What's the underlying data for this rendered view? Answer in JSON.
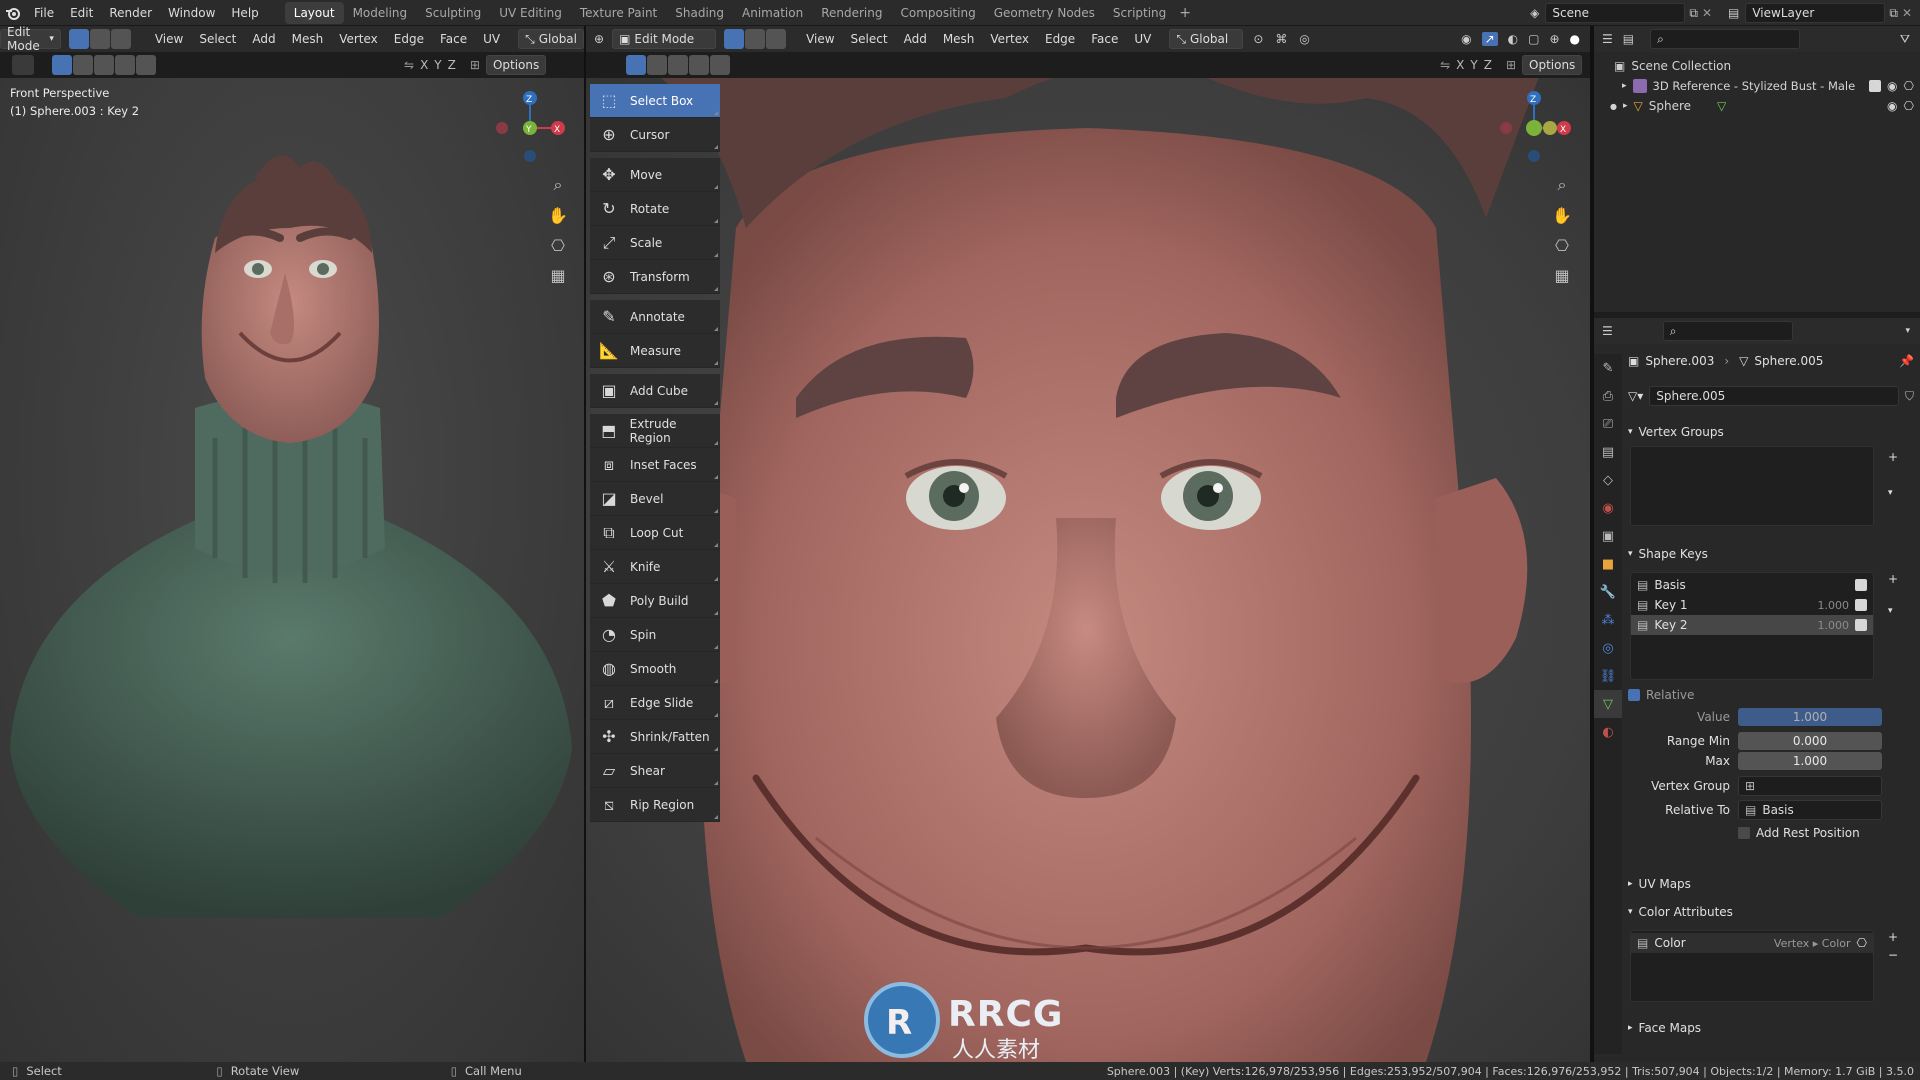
{
  "topbar": {
    "menu": [
      "File",
      "Edit",
      "Render",
      "Window",
      "Help"
    ],
    "workspaces": [
      "Layout",
      "Modeling",
      "Sculpting",
      "UV Editing",
      "Texture Paint",
      "Shading",
      "Animation",
      "Rendering",
      "Compositing",
      "Geometry Nodes",
      "Scripting"
    ],
    "active_workspace": "Layout",
    "scene_name": "Scene",
    "view_layer_name": "ViewLayer"
  },
  "left_header": {
    "mode": "Edit Mode",
    "menus": [
      "View",
      "Select",
      "Add",
      "Mesh",
      "Vertex",
      "Edge",
      "Face",
      "UV"
    ],
    "orientation": "Global",
    "axes": [
      "X",
      "Y",
      "Z"
    ],
    "options_label": "Options"
  },
  "right_header": {
    "mode": "Edit Mode",
    "menus": [
      "View",
      "Select",
      "Add",
      "Mesh",
      "Vertex",
      "Edge",
      "Face",
      "UV"
    ],
    "orientation": "Global",
    "axes": [
      "X",
      "Y",
      "Z"
    ],
    "options_label": "Options"
  },
  "left_viewport": {
    "view_name": "Front Perspective",
    "object_info": "(1) Sphere.003 : Key 2"
  },
  "toolbar": {
    "tools": [
      {
        "label": "Select Box",
        "icon": "select-box-icon",
        "active": true,
        "gap": false
      },
      {
        "label": "Cursor",
        "icon": "cursor-icon",
        "active": false,
        "gap": false
      },
      {
        "label": "Move",
        "icon": "move-icon",
        "active": false,
        "gap": true
      },
      {
        "label": "Rotate",
        "icon": "rotate-icon",
        "active": false,
        "gap": false
      },
      {
        "label": "Scale",
        "icon": "scale-icon",
        "active": false,
        "gap": false
      },
      {
        "label": "Transform",
        "icon": "transform-icon",
        "active": false,
        "gap": false
      },
      {
        "label": "Annotate",
        "icon": "annotate-icon",
        "active": false,
        "gap": true
      },
      {
        "label": "Measure",
        "icon": "measure-icon",
        "active": false,
        "gap": false
      },
      {
        "label": "Add Cube",
        "icon": "add-cube-icon",
        "active": false,
        "gap": true
      },
      {
        "label": "Extrude Region",
        "icon": "extrude-region-icon",
        "active": false,
        "gap": true
      },
      {
        "label": "Inset Faces",
        "icon": "inset-faces-icon",
        "active": false,
        "gap": false
      },
      {
        "label": "Bevel",
        "icon": "bevel-icon",
        "active": false,
        "gap": false
      },
      {
        "label": "Loop Cut",
        "icon": "loop-cut-icon",
        "active": false,
        "gap": false
      },
      {
        "label": "Knife",
        "icon": "knife-icon",
        "active": false,
        "gap": false
      },
      {
        "label": "Poly Build",
        "icon": "poly-build-icon",
        "active": false,
        "gap": false
      },
      {
        "label": "Spin",
        "icon": "spin-icon",
        "active": false,
        "gap": false
      },
      {
        "label": "Smooth",
        "icon": "smooth-icon",
        "active": false,
        "gap": false
      },
      {
        "label": "Edge Slide",
        "icon": "edge-slide-icon",
        "active": false,
        "gap": false
      },
      {
        "label": "Shrink/Fatten",
        "icon": "shrink-fatten-icon",
        "active": false,
        "gap": false
      },
      {
        "label": "Shear",
        "icon": "shear-icon",
        "active": false,
        "gap": false
      },
      {
        "label": "Rip Region",
        "icon": "rip-region-icon",
        "active": false,
        "gap": false
      }
    ]
  },
  "outliner": {
    "root": "Scene Collection",
    "items": [
      {
        "label": "3D Reference - Stylized Bust - Male"
      },
      {
        "label": "Sphere"
      }
    ]
  },
  "properties": {
    "breadcrumb_object": "Sphere.003",
    "breadcrumb_mesh": "Sphere.005",
    "mesh_name": "Sphere.005",
    "vertex_groups_title": "Vertex Groups",
    "shape_keys_title": "Shape Keys",
    "shape_keys": [
      {
        "name": "Basis",
        "value": ""
      },
      {
        "name": "Key 1",
        "value": "1.000"
      },
      {
        "name": "Key 2",
        "value": "1.000",
        "selected": true
      }
    ],
    "relative_label": "Relative",
    "value_label": "Value",
    "value": "1.000",
    "range_min_label": "Range Min",
    "range_min": "0.000",
    "max_label": "Max",
    "max": "1.000",
    "vertex_group_label": "Vertex Group",
    "relative_to_label": "Relative To",
    "relative_to": "Basis",
    "add_rest_position": "Add Rest Position",
    "uv_maps_title": "UV Maps",
    "color_attributes_title": "Color Attributes",
    "color_attribute": {
      "name": "Color",
      "type": "Vertex ▸ Color"
    },
    "face_maps_title": "Face Maps"
  },
  "statusbar": {
    "select": "Select",
    "rotate_view": "Rotate View",
    "call_menu": "Call Menu",
    "stats": "Sphere.003 | (Key) Verts:126,978/253,956 | Edges:253,952/507,904 | Faces:126,976/253,952 | Tris:507,904 | Objects:1/2 | Memory: 1.7 GiB | 3.5.0"
  },
  "colors": {
    "accent": "#4772b3",
    "panel": "#282828",
    "header": "#2b2b2b",
    "skin": "#b07a72",
    "sweater": "#4f6a5f"
  },
  "watermark": {
    "latin": "RRCG",
    "cjk": "人人素材"
  }
}
